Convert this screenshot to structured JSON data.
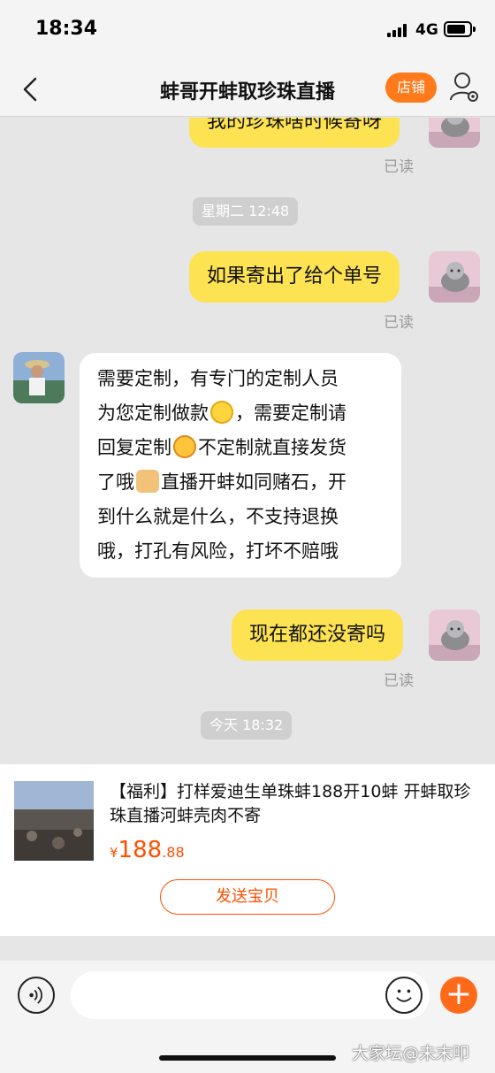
{
  "status_bar": {
    "time": "18:34",
    "network": "4G"
  },
  "nav": {
    "title": "蚌哥开蚌取珍珠直播",
    "shop_label": "店铺"
  },
  "messages": [
    {
      "side": "right",
      "text": "我的珍珠啥时候寄呀",
      "read": "已读"
    },
    {
      "side": "right",
      "text": "如果寄出了给个单号",
      "read": "已读"
    },
    {
      "side": "left",
      "lines": [
        "需要定制，有专门的定制人员",
        "为您定制做款",
        "，需要定制请",
        "回复定制",
        "不定制就直接发货",
        "了哦",
        "直播开蚌如同赌石，开",
        "到什么就是什么，不支持退换",
        "哦，打孔有风险，打坏不赔哦"
      ]
    },
    {
      "side": "right",
      "text": "现在都还没寄吗",
      "read": "已读"
    }
  ],
  "timestamps": [
    "星期二 12:48",
    "今天 18:32"
  ],
  "product": {
    "title": "【福利】打样爱迪生单珠蚌188开10蚌 开蚌取珍珠直播河蚌壳肉不寄",
    "price_symbol": "¥",
    "price_int": "188",
    "price_dec": ".88",
    "send_label": "发送宝贝"
  },
  "input": {
    "placeholder": ""
  },
  "watermark": "大家坛@未末叩",
  "colors": {
    "accent": "#ff7a1a",
    "bubble_self": "#fde251",
    "price": "#ff5000"
  }
}
